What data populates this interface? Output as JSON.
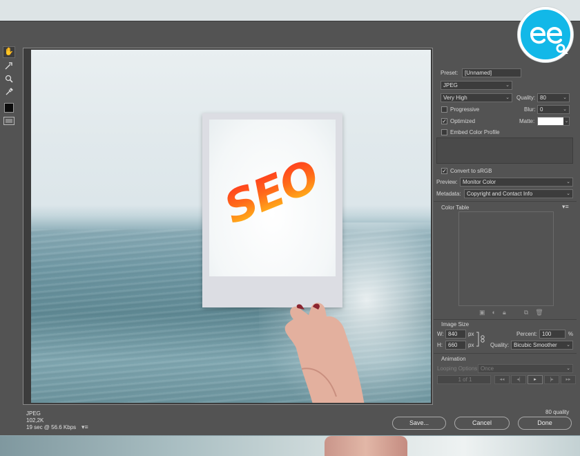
{
  "tools": [
    {
      "name": "hand-tool",
      "glyph": "✋"
    },
    {
      "name": "slice-select-tool",
      "glyph": "⟋"
    },
    {
      "name": "zoom-tool",
      "glyph": "⚲"
    },
    {
      "name": "eyedropper-tool",
      "glyph": "✎"
    }
  ],
  "preview_image": {
    "polaroid_text": "SEO"
  },
  "settings": {
    "preset_label": "Preset:",
    "preset_value": "[Unnamed]",
    "format_value": "JPEG",
    "compression_value": "Very High",
    "quality_label": "Quality:",
    "quality_value": "80",
    "progressive_label": "Progressive",
    "progressive_checked": false,
    "blur_label": "Blur:",
    "blur_value": "0",
    "optimized_label": "Optimized",
    "optimized_checked": true,
    "matte_label": "Matte:",
    "matte_color": "#ffffff",
    "embed_label": "Embed Color Profile",
    "embed_checked": false,
    "srgb_label": "Convert to sRGB",
    "srgb_checked": true,
    "preview_label": "Preview:",
    "preview_value": "Monitor Color",
    "metadata_label": "Metadata:",
    "metadata_value": "Copyright and Contact Info"
  },
  "color_table": {
    "title": "Color Table"
  },
  "image_size": {
    "title": "Image Size",
    "w_label": "W:",
    "w_value": "840",
    "h_label": "H:",
    "h_value": "660",
    "unit": "px",
    "percent_label": "Percent:",
    "percent_value": "100",
    "percent_unit": "%",
    "quality_label": "Quality:",
    "quality_value": "Bicubic Smoother"
  },
  "animation": {
    "title": "Animation",
    "looping_label": "Looping Options:",
    "looping_value": "Once",
    "frame_counter": "1 of 1"
  },
  "status": {
    "format": "JPEG",
    "size": "102,2K",
    "download_time": "19 sec @ 56.6 Kbps",
    "quality_note": "80 quality"
  },
  "buttons": {
    "save": "Save...",
    "cancel": "Cancel",
    "done": "Done"
  },
  "colors": {
    "dialog_bg": "#535353",
    "logo_blue": "#12b8e8"
  }
}
